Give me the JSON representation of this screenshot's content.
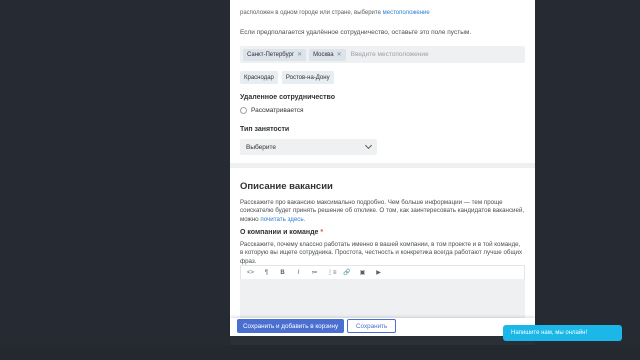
{
  "location_section": {
    "clipped_text": "расположен в одном городе или стране, выберите",
    "clipped_link": "местоположение",
    "hint": "Если предполагается удалённое сотрудничество, оставьте это поле пустым.",
    "tags": [
      "Санкт-Петербург",
      "Москва"
    ],
    "input_placeholder": "Введите местоположение",
    "suggestions": [
      "Краснодар",
      "Ростов-на-Дону"
    ]
  },
  "remote": {
    "label": "Удаленное сотрудничество",
    "option": "Рассматривается"
  },
  "employment": {
    "label": "Тип занятости",
    "selected": "Выберите"
  },
  "description": {
    "title": "Описание вакансии",
    "text": "Расскажите про вакансию максимально подробно. Чем больше информации — тем проще соискателю будет принять решение об отклике. О том, как заинтересовать кандидатов вакансией, можно",
    "link": "почитать здесь.",
    "about_label": "О компании и команде",
    "required_mark": "*",
    "about_hint": "Расскажите, почему классно работать именно в вашей компании, в том проекте и в той команде, в которую вы ищете сотрудника. Простота, честность и конкретика всегда работают лучше общих фраз.",
    "toolbar": [
      "<>",
      "¶",
      "B",
      "I",
      "≔",
      "⋮≡",
      "🔗",
      "▣",
      "▶"
    ]
  },
  "footer": {
    "save_and_add": "Сохранить и добавить в корзину",
    "save": "Сохранить"
  },
  "chat": {
    "text": "Напишите нам, мы онлайн!"
  }
}
